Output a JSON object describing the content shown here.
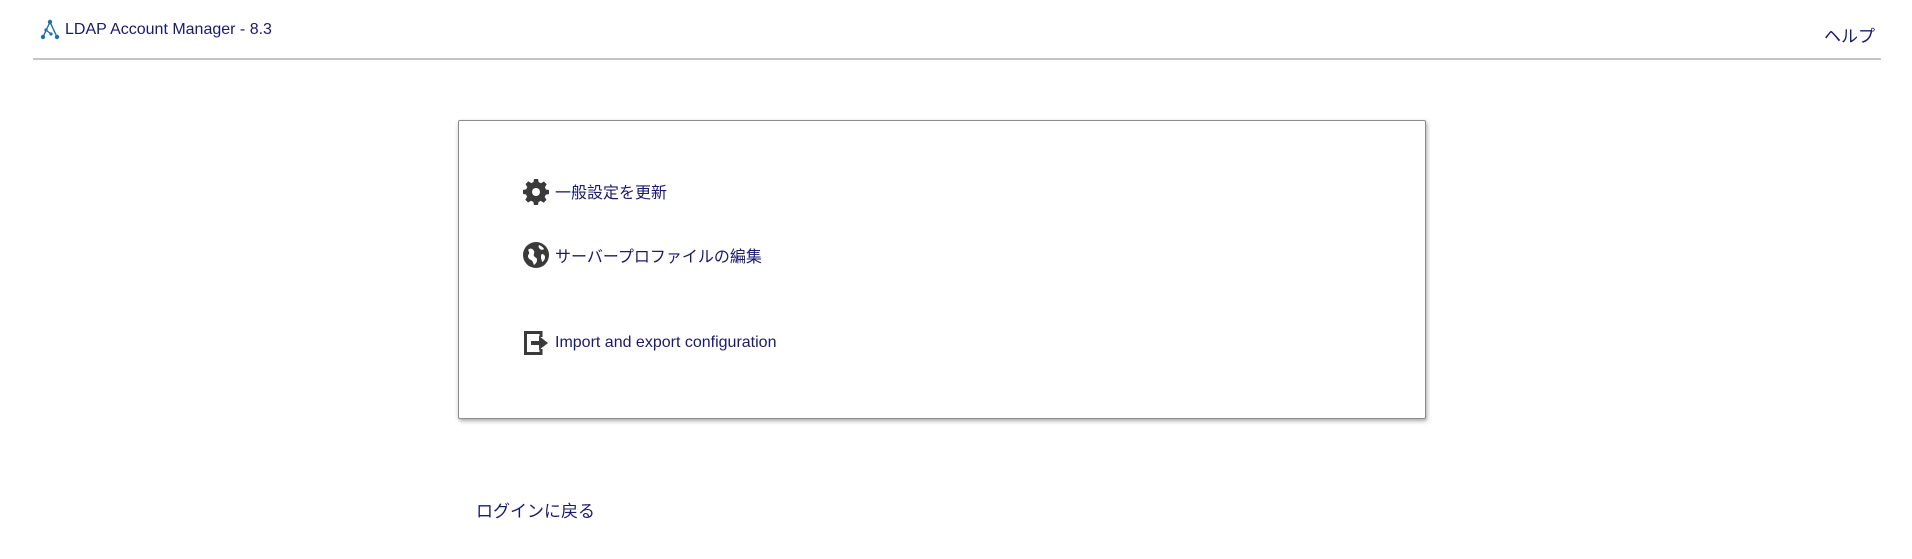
{
  "header": {
    "app_title": "LDAP Account Manager - 8.3",
    "help_label": "ヘルプ",
    "logo_icon": "lam-logo-icon"
  },
  "menu": {
    "items": [
      {
        "label": "一般設定を更新",
        "icon": "gear-icon"
      },
      {
        "label": "サーバープロファイルの編集",
        "icon": "globe-icon"
      },
      {
        "label": "Import and export configuration",
        "icon": "export-icon"
      }
    ]
  },
  "footer": {
    "back_label": "ログインに戻る"
  },
  "colors": {
    "link": "#1a1a6e",
    "icon": "#3a3a3a",
    "logo": "#1f6fa8",
    "border": "#8c8c8c",
    "divider": "#c4c4c4"
  }
}
